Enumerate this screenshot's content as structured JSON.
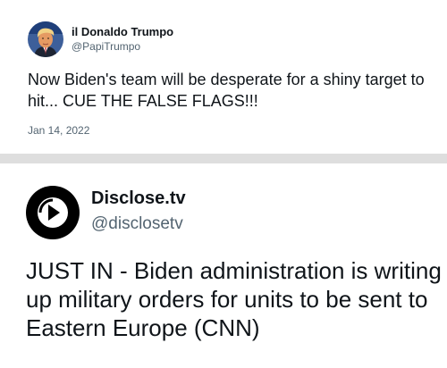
{
  "tweet1": {
    "display_name": "il Donaldo Trumpo",
    "handle": "@PapiTrumpo",
    "text": "Now Biden's team will be desperate for a shiny target to hit... CUE THE FALSE FLAGS!!!",
    "date": "Jan 14, 2022",
    "avatar_icon": "profile-photo"
  },
  "tweet2": {
    "display_name": "Disclose.tv",
    "handle": "@disclosetv",
    "text": "JUST IN - Biden administration is writing up military orders for units to be sent to Eastern Europe (CNN)",
    "avatar_icon": "disclose-tv-logo"
  },
  "colors": {
    "text_primary": "#0f1419",
    "text_secondary": "#536471",
    "divider": "#dedede",
    "background": "#ffffff"
  }
}
